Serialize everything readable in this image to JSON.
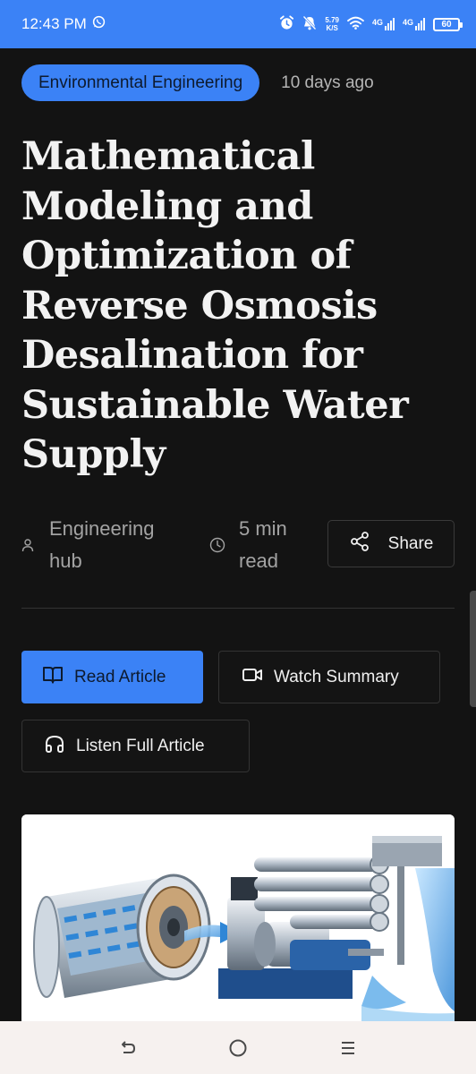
{
  "status_bar": {
    "time": "12:43 PM",
    "speed_value": "5.79",
    "speed_unit": "K/S",
    "network_1": "4G",
    "network_2": "4G",
    "battery": "60"
  },
  "article": {
    "category": "Environmental Engineering",
    "time_ago": "10 days ago",
    "title": "Mathematical Modeling and Optimization of Reverse Osmosis Desalination for Sustainable Water Supply",
    "author": "Engineering hub",
    "read_time": "5 min read"
  },
  "actions": {
    "share_label": "Share",
    "read_label": "Read Article",
    "watch_label": "Watch Summary",
    "listen_label": "Listen Full Article"
  },
  "colors": {
    "accent": "#3b82f6",
    "background": "#131313",
    "nav_bar": "#f6f1ef"
  },
  "icons": {
    "whatsapp": "whatsapp-icon",
    "alarm": "alarm-icon",
    "mute": "bell-off-icon",
    "wifi": "wifi-icon",
    "author": "user-icon",
    "clock": "clock-icon",
    "share": "share-icon",
    "read": "book-open-icon",
    "watch": "video-icon",
    "listen": "headphones-icon",
    "back": "back-icon",
    "home": "home-icon",
    "recents": "menu-icon"
  }
}
